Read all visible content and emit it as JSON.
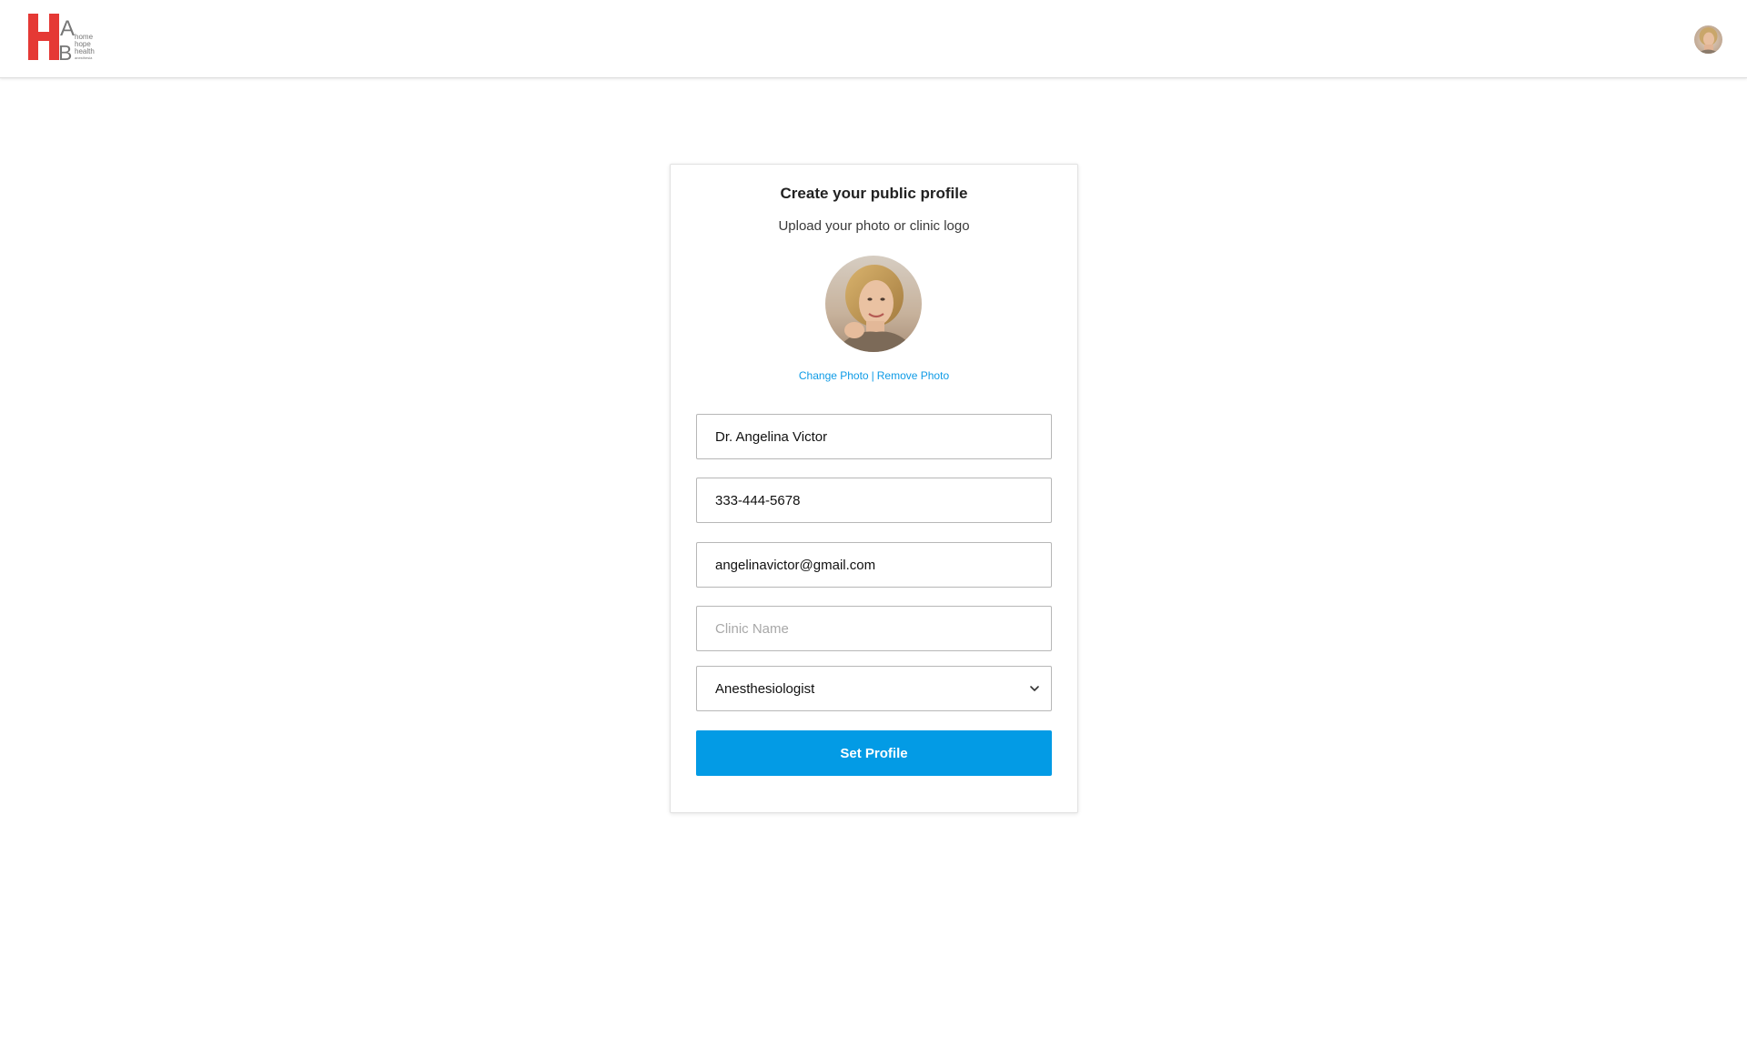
{
  "header": {
    "logo": {
      "letters": [
        "H",
        "A",
        "B"
      ],
      "wordmark": [
        "home",
        "hope",
        "health",
        "anesthesia"
      ]
    }
  },
  "card": {
    "title": "Create your public profile",
    "subtitle": "Upload your photo or clinic logo",
    "photo_actions": {
      "change": "Change Photo",
      "separator": "|",
      "remove": "Remove Photo"
    },
    "fields": {
      "name": {
        "value": "Dr. Angelina Victor"
      },
      "phone": {
        "value": "333-444-5678"
      },
      "email": {
        "value": "angelinavictor@gmail.com"
      },
      "clinic": {
        "value": "",
        "placeholder": "Clinic Name"
      }
    },
    "specialty": {
      "selected": "Anesthesiologist"
    },
    "submit_label": "Set Profile"
  },
  "colors": {
    "accent": "#039be5",
    "link": "#0e9be6",
    "logo_red": "#e53935",
    "logo_gray": "#777777"
  }
}
